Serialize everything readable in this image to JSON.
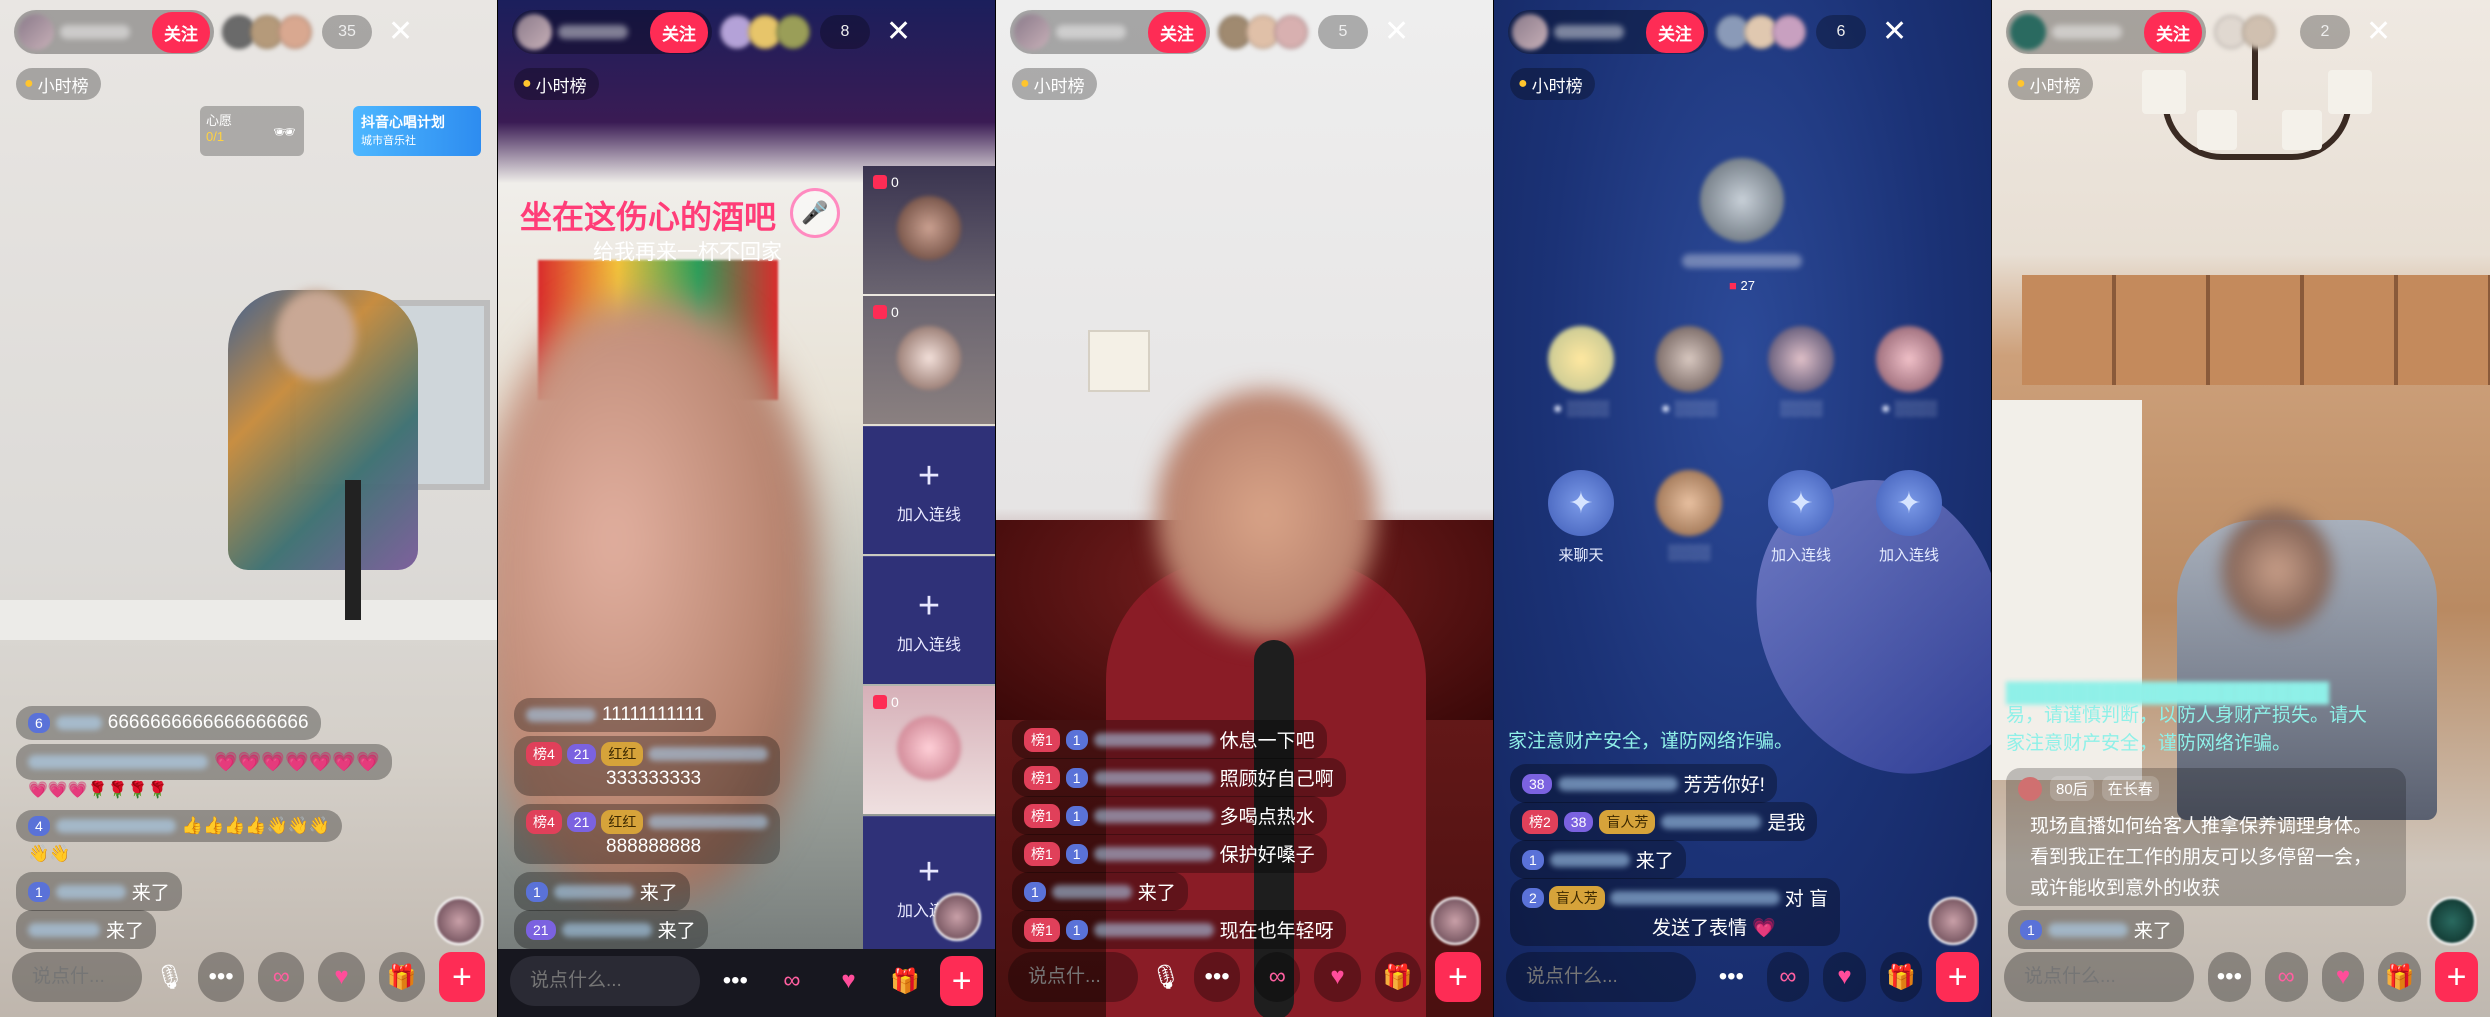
{
  "common": {
    "follow_label": "关注",
    "hourly_rank": "小时榜",
    "input_placeholder": "说点什么...",
    "input_placeholder_short": "说点什...",
    "plus": "+",
    "close": "✕"
  },
  "panels": [
    {
      "viewer_count": "35",
      "gift_card": {
        "title": "心愿",
        "progress": "0/1"
      },
      "promo": {
        "title": "抖音心唱计划",
        "subtitle": "城市音乐社"
      },
      "comments": [
        {
          "badge": "6",
          "text": "6666666666666666666"
        },
        {
          "text": "💗💗💗💗💗💗💗"
        },
        {
          "text": "💗💗💗🌹🌹🌹🌹"
        },
        {
          "badge": "4",
          "text": "👍👍👍👍👋👋👋"
        },
        {
          "text": "👋👋"
        },
        {
          "badge": "1",
          "text": "来了"
        },
        {
          "text": "来了"
        }
      ]
    },
    {
      "viewer_count": "8",
      "song_title": "坐在这伤心的酒吧",
      "song_sub": "给我再来一杯不回家",
      "seats": [
        {
          "count": "0"
        },
        {
          "count": "0"
        },
        {
          "count": "0"
        }
      ],
      "add_seat_label": "加入连线",
      "comments": [
        {
          "text": "11111111111"
        },
        {
          "rank": "榜4",
          "level": "21",
          "fan": "红红",
          "text": "333333333"
        },
        {
          "rank": "榜4",
          "level": "21",
          "fan": "红红",
          "text": "888888888"
        },
        {
          "badge": "1",
          "text": "来了"
        },
        {
          "badge": "21",
          "text": "来了"
        }
      ]
    },
    {
      "viewer_count": "5",
      "comments": [
        {
          "rank": "榜1",
          "badge": "1",
          "text": "休息一下吧"
        },
        {
          "rank": "榜1",
          "badge": "1",
          "text": "照顾好自己啊"
        },
        {
          "rank": "榜1",
          "badge": "1",
          "text": "多喝点热水"
        },
        {
          "rank": "榜1",
          "badge": "1",
          "text": "保护好嗓子"
        },
        {
          "badge": "1",
          "text": "来了"
        },
        {
          "rank": "榜1",
          "badge": "1",
          "text": "现在也年轻呀"
        }
      ]
    },
    {
      "viewer_count": "6",
      "host_seat_count": "27",
      "chat_seats": [
        {
          "label": "来聊天"
        },
        {
          "label": "加入连线"
        },
        {
          "label": "加入连线"
        }
      ],
      "notice": "家注意财产安全，谨防网络诈骗。",
      "comments": [
        {
          "level": "38",
          "text": "芳芳你好!"
        },
        {
          "rank": "榜2",
          "level": "38",
          "fan": "盲人芳",
          "text": "是我"
        },
        {
          "badge": "1",
          "text": "来了"
        },
        {
          "badge": "2",
          "fan": "盲人芳",
          "text": "对 盲"
        },
        {
          "text": "发送了表情 💗"
        }
      ]
    },
    {
      "viewer_count": "2",
      "notice1": "易，请谨慎判断，以防人身财产损失。请大",
      "notice2": "家注意财产安全，谨防网络诈骗。",
      "host_comment": {
        "age": "80后",
        "location": "在长春",
        "line1": "现场直播如何给客人推拿保养调理身体。",
        "line2": "看到我正在工作的朋友可以多停留一会，",
        "line3": "或许能收到意外的收获"
      },
      "comments": [
        {
          "badge": "1",
          "text": "来了"
        }
      ]
    }
  ]
}
